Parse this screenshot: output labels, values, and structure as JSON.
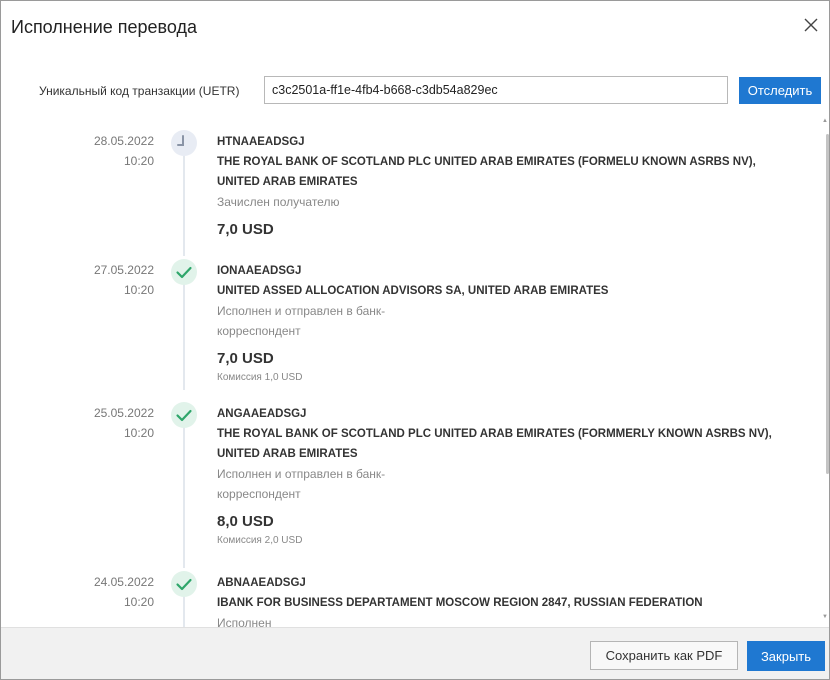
{
  "dialog": {
    "title": "Исполнение перевода",
    "close_icon": "close-icon"
  },
  "uetr": {
    "label": "Уникальный код транзакции (UETR)",
    "value": "c3c2501a-ff1e-4fb4-b668-c3db54a829ec",
    "track_button": "Отследить"
  },
  "events": [
    {
      "date": "28.05.2022",
      "time": "10:20",
      "icon": "pending-clock-icon",
      "bic": "HTNAAEADSGJ",
      "bank_line1": "THE ROYAL BANK OF SCOTLAND PLC UNITED ARAB EMIRATES (FORMELU KNOWN ASRBS NV),",
      "bank_line2": "UNITED ARAB EMIRATES",
      "status_line1": "Зачислен получателю",
      "status_line2": "",
      "amount": "7,0 USD",
      "commission": ""
    },
    {
      "date": "27.05.2022",
      "time": "10:20",
      "icon": "checkmark-icon",
      "bic": "IONAAEADSGJ",
      "bank_line1": "UNITED ASSED ALLOCATION ADVISORS SA, UNITED ARAB EMIRATES",
      "bank_line2": "",
      "status_line1": "Исполнен и отправлен в банк-",
      "status_line2": "корреспондент",
      "amount": "7,0 USD",
      "commission": "Комиссия 1,0 USD"
    },
    {
      "date": "25.05.2022",
      "time": "10:20",
      "icon": "checkmark-icon",
      "bic": "ANGAAEADSGJ",
      "bank_line1": "THE ROYAL BANK OF SCOTLAND PLC UNITED ARAB EMIRATES (FORMMERLY KNOWN ASRBS NV),",
      "bank_line2": "UNITED ARAB EMIRATES",
      "status_line1": "Исполнен и отправлен в банк-",
      "status_line2": "корреспондент",
      "amount": "8,0 USD",
      "commission": "Комиссия 2,0 USD"
    },
    {
      "date": "24.05.2022",
      "time": "10:20",
      "icon": "checkmark-icon",
      "bic": "ABNAAEADSGJ",
      "bank_line1": "IBANK FOR BUSINESS DEPARTAMENT MOSCOW REGION 2847, RUSSIAN FEDERATION",
      "bank_line2": "",
      "status_line1": "Исполнен",
      "status_line2": "",
      "amount": "",
      "commission": ""
    }
  ],
  "footer": {
    "save_pdf_button": "Сохранить как PDF",
    "close_button": "Закрыть"
  },
  "colors": {
    "accent": "#1f78d1",
    "success": "#2fa66b",
    "pending": "#8a94a6"
  }
}
